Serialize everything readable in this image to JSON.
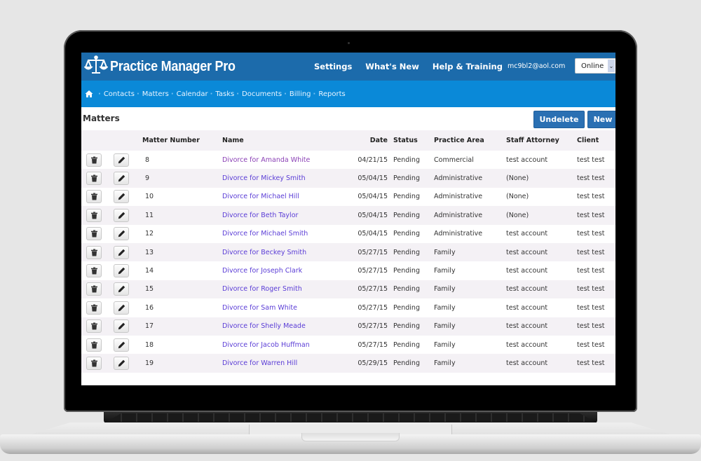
{
  "app": {
    "title": "Practice Manager Pro",
    "logo_icon": "scales-of-justice-icon"
  },
  "topnav": {
    "items": [
      {
        "label": "Settings"
      },
      {
        "label": "What's New"
      },
      {
        "label": "Help & Training"
      }
    ],
    "user_email": "mc9bl2@aol.com",
    "status_select": {
      "selected": "Online",
      "icon": "chevron-down-icon"
    }
  },
  "subnav": {
    "home_icon": "home-icon",
    "items": [
      {
        "label": "Contacts"
      },
      {
        "label": "Matters"
      },
      {
        "label": "Calendar"
      },
      {
        "label": "Tasks"
      },
      {
        "label": "Documents"
      },
      {
        "label": "Billing"
      },
      {
        "label": "Reports"
      }
    ]
  },
  "page": {
    "title": "Matters",
    "buttons": {
      "undelete": "Undelete",
      "new": "New"
    }
  },
  "table": {
    "columns": [
      "",
      "",
      "Matter Number",
      "Name",
      "Date",
      "Status",
      "Practice Area",
      "Staff Attorney",
      "Client"
    ],
    "row_actions": {
      "delete_icon": "trash-icon",
      "edit_icon": "pencil-icon"
    },
    "rows": [
      {
        "number": "8",
        "name": "Divorce for Amanda White",
        "date": "04/21/15",
        "status": "Pending",
        "practice_area": "Commercial",
        "attorney": "test account",
        "client": "test test",
        "visited": true
      },
      {
        "number": "9",
        "name": "Divorce for Mickey Smith",
        "date": "05/04/15",
        "status": "Pending",
        "practice_area": "Administrative",
        "attorney": "(None)",
        "client": "test test",
        "visited": false
      },
      {
        "number": "10",
        "name": "Divorce for Michael Hill",
        "date": "05/04/15",
        "status": "Pending",
        "practice_area": "Administrative",
        "attorney": "(None)",
        "client": "test test",
        "visited": false
      },
      {
        "number": "11",
        "name": "Divorce for Beth Taylor",
        "date": "05/04/15",
        "status": "Pending",
        "practice_area": "Administrative",
        "attorney": "(None)",
        "client": "test test",
        "visited": false
      },
      {
        "number": "12",
        "name": "Divorce for Michael Smith",
        "date": "05/04/15",
        "status": "Pending",
        "practice_area": "Administrative",
        "attorney": "test account",
        "client": "test test",
        "visited": false
      },
      {
        "number": "13",
        "name": "Divorce for Beckey Smith",
        "date": "05/27/15",
        "status": "Pending",
        "practice_area": "Family",
        "attorney": "test account",
        "client": "test test",
        "visited": false
      },
      {
        "number": "14",
        "name": "Divorce for Joseph Clark",
        "date": "05/27/15",
        "status": "Pending",
        "practice_area": "Family",
        "attorney": "test account",
        "client": "test test",
        "visited": false
      },
      {
        "number": "15",
        "name": "Divorce for Roger Smith",
        "date": "05/27/15",
        "status": "Pending",
        "practice_area": "Family",
        "attorney": "test account",
        "client": "test test",
        "visited": false
      },
      {
        "number": "16",
        "name": "Divorce for Sam White",
        "date": "05/27/15",
        "status": "Pending",
        "practice_area": "Family",
        "attorney": "test account",
        "client": "test test",
        "visited": false
      },
      {
        "number": "17",
        "name": "Divorce for Shelly Meade",
        "date": "05/27/15",
        "status": "Pending",
        "practice_area": "Family",
        "attorney": "test account",
        "client": "test test",
        "visited": false
      },
      {
        "number": "18",
        "name": "Divorce for Jacob Huffman",
        "date": "05/27/15",
        "status": "Pending",
        "practice_area": "Family",
        "attorney": "test account",
        "client": "test test",
        "visited": false
      },
      {
        "number": "19",
        "name": "Divorce for Warren Hill",
        "date": "05/29/15",
        "status": "Pending",
        "practice_area": "Family",
        "attorney": "test account",
        "client": "test test",
        "visited": false
      }
    ]
  },
  "colors": {
    "topbar": "#1c6bab",
    "subnav": "#0a89d8",
    "button": "#2a70b3",
    "link": "#5a3cd6",
    "link_visited": "#8a3fb5",
    "row_alt": "#f4f1f5"
  }
}
